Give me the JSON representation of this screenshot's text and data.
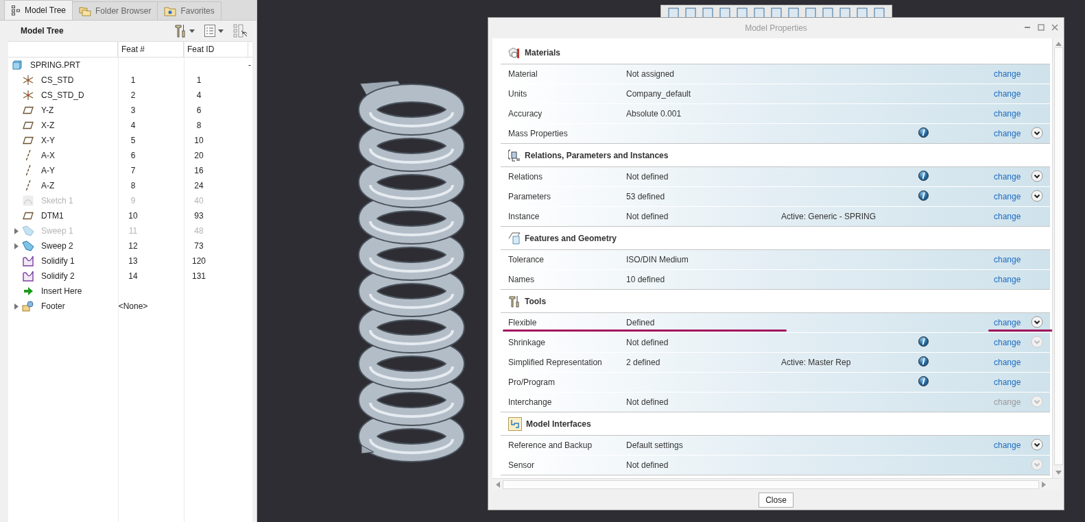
{
  "tabs": [
    {
      "label": "Model Tree",
      "selected": true,
      "kind": "tree"
    },
    {
      "label": "Folder Browser",
      "selected": false,
      "kind": "folder"
    },
    {
      "label": "Favorites",
      "selected": false,
      "kind": "favorites"
    }
  ],
  "model_tree": {
    "title": "Model Tree",
    "columns": [
      "Feat #",
      "Feat ID"
    ],
    "root": {
      "name": "SPRING.PRT",
      "kind": "part",
      "disabled": false,
      "column_4": "-",
      "children": [
        {
          "name": "CS_STD",
          "kind": "csys",
          "feat_no": "1",
          "feat_id": "1",
          "disabled": false
        },
        {
          "name": "CS_STD_D",
          "kind": "csys",
          "feat_no": "2",
          "feat_id": "4",
          "disabled": false
        },
        {
          "name": "Y-Z",
          "kind": "plane",
          "feat_no": "3",
          "feat_id": "6",
          "disabled": false
        },
        {
          "name": "X-Z",
          "kind": "plane",
          "feat_no": "4",
          "feat_id": "8",
          "disabled": false
        },
        {
          "name": "X-Y",
          "kind": "plane",
          "feat_no": "5",
          "feat_id": "10",
          "disabled": false
        },
        {
          "name": "A-X",
          "kind": "axis",
          "feat_no": "6",
          "feat_id": "20",
          "disabled": false
        },
        {
          "name": "A-Y",
          "kind": "axis",
          "feat_no": "7",
          "feat_id": "16",
          "disabled": false
        },
        {
          "name": "A-Z",
          "kind": "axis",
          "feat_no": "8",
          "feat_id": "24",
          "disabled": false
        },
        {
          "name": "Sketch 1",
          "kind": "sketch",
          "feat_no": "9",
          "feat_id": "40",
          "disabled": true
        },
        {
          "name": "DTM1",
          "kind": "plane",
          "feat_no": "10",
          "feat_id": "93",
          "disabled": false
        },
        {
          "name": "Sweep 1",
          "kind": "sweep",
          "feat_no": "11",
          "feat_id": "48",
          "disabled": true,
          "expanded": false
        },
        {
          "name": "Sweep 2",
          "kind": "sweep",
          "feat_no": "12",
          "feat_id": "73",
          "disabled": false,
          "expanded": false
        },
        {
          "name": "Solidify 1",
          "kind": "solidify",
          "feat_no": "13",
          "feat_id": "120",
          "disabled": false
        },
        {
          "name": "Solidify 2",
          "kind": "solidify",
          "feat_no": "14",
          "feat_id": "131",
          "disabled": false
        },
        {
          "name": "Insert Here",
          "kind": "insert",
          "disabled": false
        },
        {
          "name": "Footer",
          "kind": "footer",
          "feat_no": "<None>",
          "disabled": false,
          "expanded": false
        }
      ]
    }
  },
  "dialog": {
    "title": "Model Properties",
    "close_button": "Close",
    "sections": [
      {
        "title": "Materials",
        "kind": "materials",
        "rows": [
          {
            "label": "Material",
            "value": "Not assigned",
            "info": false,
            "change": "change",
            "change_disabled": false,
            "annotated": false
          },
          {
            "label": "Units",
            "value": "Company_default",
            "info": false,
            "change": "change",
            "change_disabled": false,
            "annotated": false
          },
          {
            "label": "Accuracy",
            "value": "Absolute 0.001",
            "info": false,
            "change": "change",
            "change_disabled": false,
            "annotated": false
          },
          {
            "label": "Mass Properties",
            "info": true,
            "change": "change",
            "change_disabled": false,
            "expandable": true,
            "expander_disabled": false,
            "annotated": false
          }
        ]
      },
      {
        "title": "Relations, Parameters and Instances",
        "kind": "relations",
        "rows": [
          {
            "label": "Relations",
            "value": "Not defined",
            "info": true,
            "change": "change",
            "change_disabled": false,
            "expandable": true,
            "expander_disabled": false,
            "annotated": false
          },
          {
            "label": "Parameters",
            "value": "53 defined",
            "info": true,
            "change": "change",
            "change_disabled": false,
            "expandable": true,
            "expander_disabled": false,
            "annotated": false
          },
          {
            "label": "Instance",
            "value": "Not defined",
            "extra": "Active: Generic - SPRING",
            "info": false,
            "change": "change",
            "change_disabled": false,
            "annotated": false
          }
        ]
      },
      {
        "title": "Features and Geometry",
        "kind": "features",
        "rows": [
          {
            "label": "Tolerance",
            "value": "ISO/DIN Medium",
            "info": false,
            "change": "change",
            "change_disabled": false,
            "annotated": false
          },
          {
            "label": "Names",
            "value": "10 defined",
            "info": false,
            "change": "change",
            "change_disabled": false,
            "annotated": false
          }
        ]
      },
      {
        "title": "Tools",
        "kind": "tools",
        "rows": [
          {
            "label": "Flexible",
            "value": "Defined",
            "info": false,
            "change": "change",
            "change_disabled": false,
            "expandable": true,
            "expander_disabled": false,
            "annotated": true
          },
          {
            "label": "Shrinkage",
            "value": "Not defined",
            "info": true,
            "change": "change",
            "change_disabled": false,
            "expandable": true,
            "expander_disabled": true,
            "annotated": false
          },
          {
            "label": "Simplified Representation",
            "value": "2 defined",
            "extra": "Active: Master Rep",
            "info": true,
            "change": "change",
            "change_disabled": false,
            "annotated": false
          },
          {
            "label": "Pro/Program",
            "info": true,
            "change": "change",
            "change_disabled": false,
            "annotated": false
          },
          {
            "label": "Interchange",
            "value": "Not defined",
            "info": false,
            "change": "change",
            "change_disabled": true,
            "expandable": true,
            "expander_disabled": true,
            "annotated": false
          }
        ]
      },
      {
        "title": "Model Interfaces",
        "kind": "interfaces",
        "rows": [
          {
            "label": "Reference and Backup",
            "value": "Default settings",
            "info": false,
            "change": "change",
            "change_disabled": false,
            "expandable": true,
            "expander_disabled": false,
            "annotated": false
          },
          {
            "label": "Sensor",
            "value": "Not defined",
            "info": false,
            "expandable": true,
            "expander_disabled": true,
            "annotated": false
          }
        ]
      }
    ]
  }
}
